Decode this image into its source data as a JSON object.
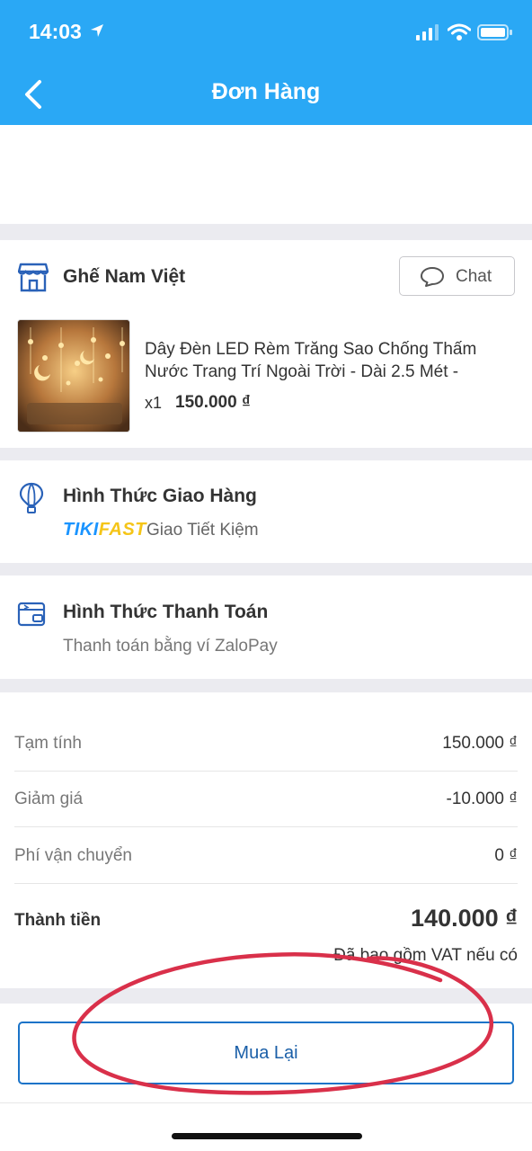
{
  "status_bar": {
    "time": "14:03"
  },
  "header": {
    "title": "Đơn Hàng"
  },
  "shop": {
    "name": "Ghế Nam Việt",
    "chat_label": "Chat"
  },
  "product": {
    "name_line1": "Dây Đèn LED Rèm Trăng Sao Chống Thấm",
    "name_line2": "Nước Trang Trí Ngoài Trời - Dài 2.5 Mét -",
    "quantity": "x1",
    "price": "150.000 ₫"
  },
  "shipping": {
    "title": "Hình Thức Giao Hàng",
    "brand": "TIKIFAST",
    "method": "Giao Tiết Kiệm"
  },
  "payment": {
    "title": "Hình Thức Thanh Toán",
    "method": "Thanh toán bằng ví ZaloPay"
  },
  "summary": {
    "rows": [
      {
        "label": "Tạm tính",
        "value": "150.000 ₫"
      },
      {
        "label": "Giảm giá",
        "value": "-10.000 ₫"
      },
      {
        "label": "Phí vận chuyển",
        "value": "0 ₫"
      }
    ],
    "total_label": "Thành tiền",
    "total_value": "140.000 ₫",
    "vat_note": "Đã bao gồm VAT nếu có"
  },
  "actions": {
    "rebuy_label": "Mua Lại"
  },
  "colors": {
    "header": "#2aa8f5",
    "accent_button": "#1a73c8",
    "annotation": "#d9304a",
    "tiki_blue": "#1a94ff",
    "tiki_yellow": "#f5c518"
  }
}
